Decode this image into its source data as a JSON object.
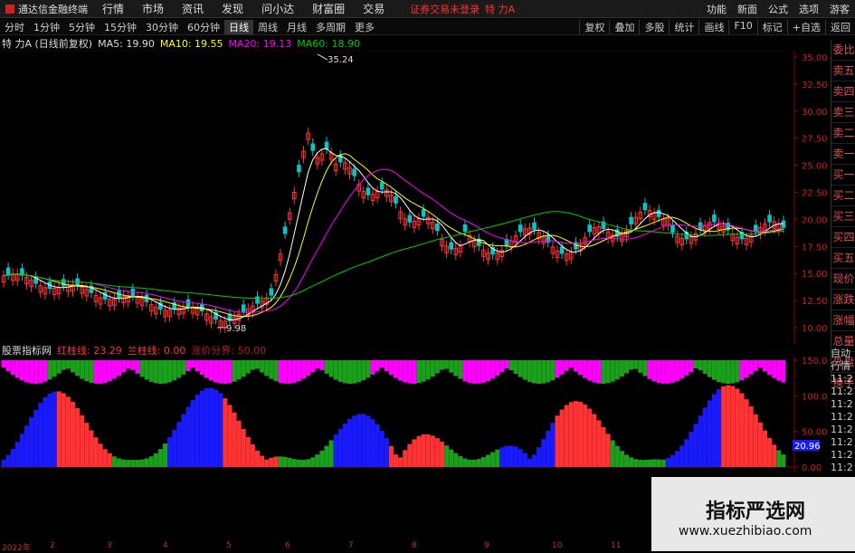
{
  "menu": {
    "app_title": "通达信金融终端",
    "items": [
      "行情",
      "市场",
      "资讯",
      "发现",
      "问小达",
      "财富圈",
      "交易"
    ],
    "warning": "证券交易未登录",
    "stock_title": "特 力A",
    "right_items": [
      "功能",
      "新面",
      "公式",
      "选项",
      "游客"
    ]
  },
  "periods": [
    "分时",
    "1分钟",
    "5分钟",
    "15分钟",
    "30分钟",
    "60分钟",
    "日线",
    "周线",
    "月线",
    "多周期",
    "更多"
  ],
  "active_period": "日线",
  "tools": [
    "复权",
    "叠加",
    "多股",
    "统计",
    "画线",
    "F10",
    "标记",
    "+自选",
    "返回"
  ],
  "info": {
    "name": "特 力A (日线前复权)",
    "ma5": "MA5: 19.90",
    "ma10": "MA10: 19.55",
    "ma20": "MA20: 19.13",
    "ma60": "MA60: 18.90"
  },
  "price_axis": {
    "ticks": [
      "35.00",
      "32.50",
      "30.00",
      "27.50",
      "25.00",
      "22.50",
      "20.00",
      "17.50",
      "15.00",
      "12.50",
      "10.00"
    ],
    "high_label": "35.24",
    "low_label": "9.98"
  },
  "indicator": {
    "name": "股票指标网",
    "red_label": "红柱线: 23.29",
    "blue_label": "兰柱线: 0.00",
    "extra_label": "涨价分界: 50.00",
    "ticks": [
      "150.0",
      "100.0",
      "50.00",
      "0.00"
    ],
    "current": "20.96"
  },
  "right_panel": [
    "委比",
    "卖五",
    "卖四",
    "卖三",
    "卖二",
    "卖一",
    "买一",
    "买二",
    "买三",
    "买四",
    "买五",
    "现价",
    "涨跌",
    "涨幅",
    "总量",
    "外盘",
    "换手",
    "净资",
    "收益"
  ],
  "right_panel2": [
    "自动",
    "行情",
    "11:2",
    "11:2",
    "11:2",
    "11:2",
    "11:2",
    "11:2",
    "11:2",
    "11:2"
  ],
  "x_axis": [
    "2022年",
    "2",
    "3",
    "4",
    "5",
    "6",
    "7",
    "8",
    "9",
    "10",
    "11",
    "12"
  ],
  "watermark": {
    "name": "指标严选网",
    "url": "www.xuezhibiao.com"
  },
  "colors": {
    "up": "#ff3333",
    "down": "#00c8c8",
    "ma5": "#ffffff",
    "ma10": "#ffff00",
    "ma20": "#ff00ff",
    "ma60": "#00cc00",
    "blue": "#1a1aff",
    "magenta": "#ff00ff",
    "green": "#1aa01a"
  }
}
